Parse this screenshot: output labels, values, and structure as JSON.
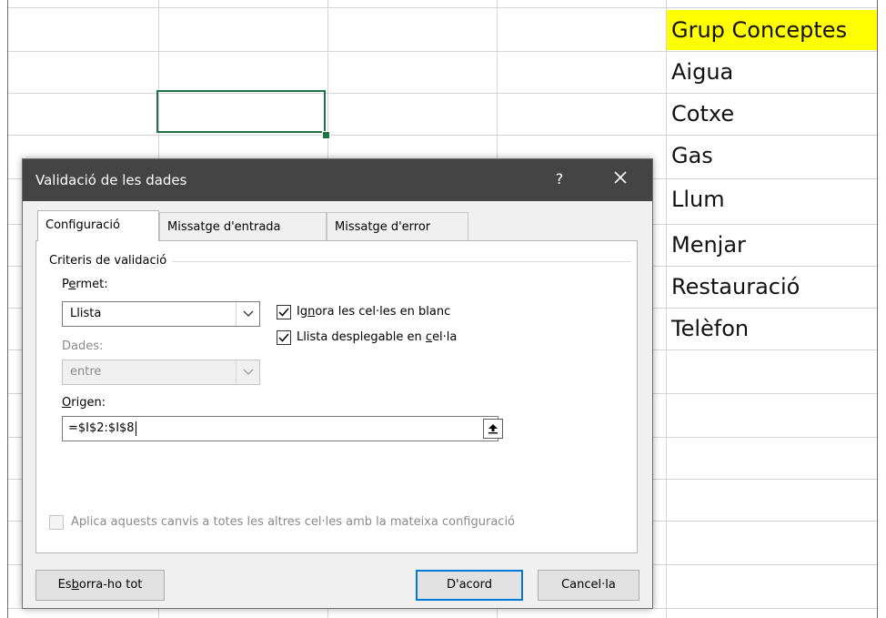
{
  "spreadsheet": {
    "list_header": "Grup Conceptes",
    "list_items": [
      "Aigua",
      "Cotxe",
      "Gas",
      "Llum",
      "Menjar",
      "Restauració",
      "Telèfon"
    ],
    "colors": {
      "header_highlight": "#ffff00",
      "selection": "#217346",
      "gridline": "#d4d4d4"
    }
  },
  "dialog": {
    "title": "Validació de les dades",
    "help_label": "?",
    "close_icon": "close-icon",
    "tabs": [
      {
        "label": "Configuració",
        "active": true
      },
      {
        "label": "Missatge d'entrada",
        "active": false
      },
      {
        "label": "Missatge d'error",
        "active": false
      }
    ],
    "group_label": "Criteris de validació",
    "allow": {
      "label_prefix": "P",
      "label_accel": "e",
      "label_suffix": "rmet:",
      "value": "Llista"
    },
    "data": {
      "label": "Dades:",
      "value": "entre"
    },
    "ignore_blank": {
      "prefix": "Ig",
      "accel": "n",
      "suffix": "ora les cel·les en blanc",
      "checked": true
    },
    "in_cell_dropdown": {
      "prefix": "Llista desplegable en ",
      "accel": "c",
      "suffix": "el·la",
      "checked": true
    },
    "source": {
      "label_accel": "O",
      "label_suffix": "rigen:",
      "value": "=$I$2:$I$8",
      "ref_icon": "collapse-dialog-arrow-icon"
    },
    "apply_all": {
      "label": "Aplica aquests canvis a totes les altres cel·les amb la mateixa configuració",
      "checked": false,
      "disabled": true
    },
    "buttons": {
      "clear_prefix": "Es",
      "clear_accel": "b",
      "clear_suffix": "orra-ho tot",
      "ok": "D'acord",
      "cancel": "Cancel·la"
    },
    "colors": {
      "titlebar": "#444444",
      "default_button_border": "#0078d7"
    }
  }
}
